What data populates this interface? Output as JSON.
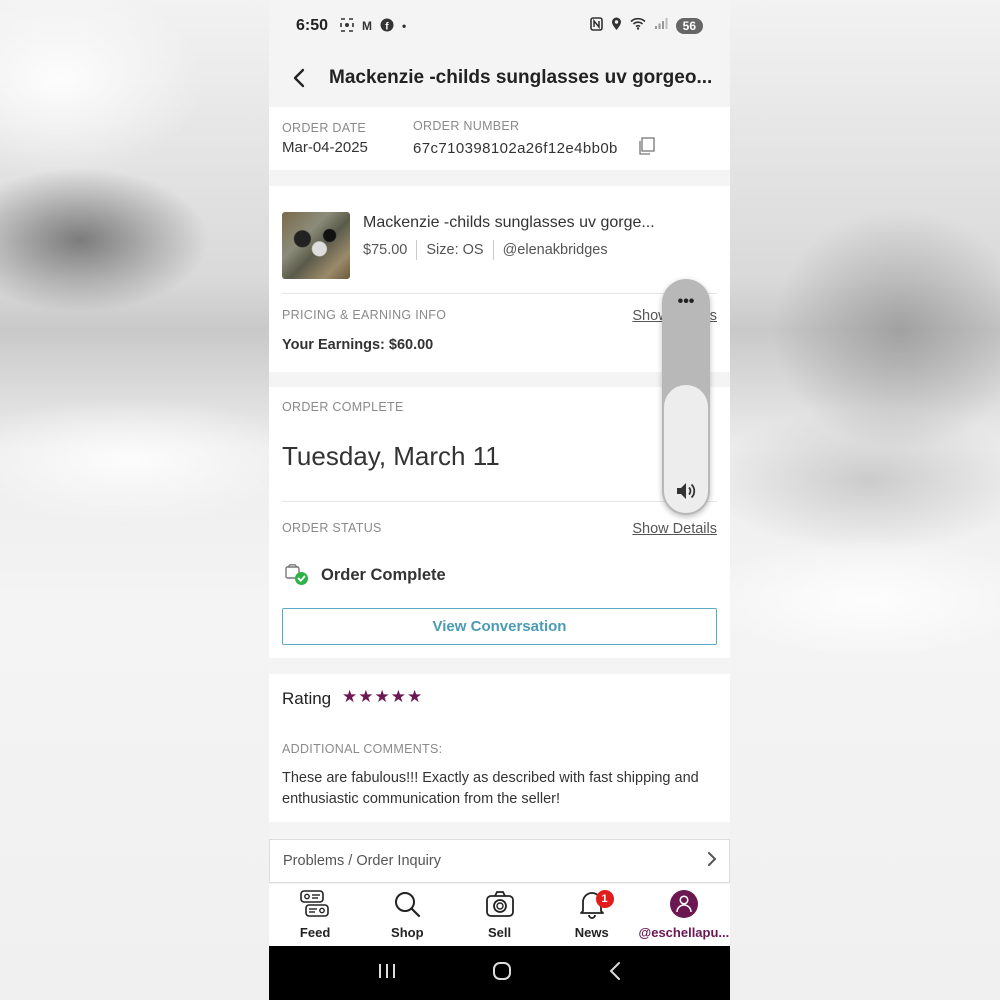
{
  "status_bar": {
    "time": "6:50",
    "battery": "56"
  },
  "header": {
    "title": "Mackenzie -childs sunglasses uv gorgeo..."
  },
  "order_info": {
    "date_label": "ORDER DATE",
    "date_value": "Mar-04-2025",
    "number_label": "ORDER NUMBER",
    "number_value": "67c710398102a26f12e4bb0b"
  },
  "item": {
    "title": "Mackenzie -childs sunglasses uv gorge...",
    "price": "$75.00",
    "size": "Size: OS",
    "seller": "@elenakbridges"
  },
  "pricing": {
    "label": "PRICING & EARNING INFO",
    "show_details": "Show Details",
    "earnings": "Your Earnings: $60.00"
  },
  "order_complete": {
    "label": "ORDER COMPLETE",
    "date": "Tuesday, March 11"
  },
  "order_status": {
    "label": "ORDER STATUS",
    "show_details": "Show Details",
    "status": "Order Complete",
    "button": "View Conversation"
  },
  "rating": {
    "label": "Rating",
    "stars": 5,
    "comments_label": "ADDITIONAL COMMENTS:",
    "comments": "These are fabulous!!! Exactly as described with fast shipping and enthusiastic communication from the seller!"
  },
  "problems": {
    "label": "Problems / Order Inquiry"
  },
  "bottom_nav": {
    "items": [
      {
        "label": "Feed",
        "icon": "feed-icon"
      },
      {
        "label": "Shop",
        "icon": "search-icon"
      },
      {
        "label": "Sell",
        "icon": "camera-icon"
      },
      {
        "label": "News",
        "icon": "bell-icon",
        "badge": "1"
      },
      {
        "label": "@eschellapu...",
        "icon": "avatar-icon"
      }
    ]
  },
  "volume": {
    "level": 0.55
  },
  "colors": {
    "brand": "#6a1752",
    "accent": "#4a9bb6",
    "success": "#2fb14a"
  }
}
